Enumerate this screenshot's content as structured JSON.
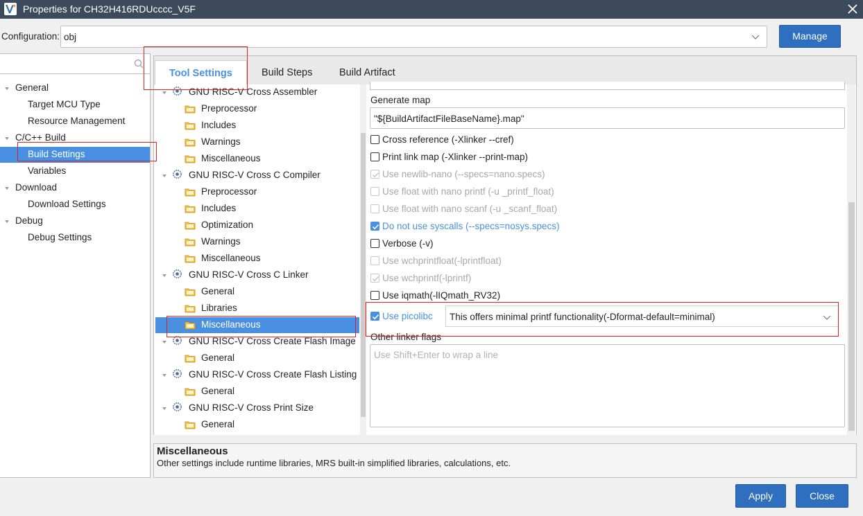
{
  "window": {
    "title": "Properties for CH32H416RDUcccc_V5F"
  },
  "config": {
    "label": "Configuration:",
    "value": "obj",
    "manage_label": "Manage"
  },
  "left_tree": {
    "filter_placeholder": "",
    "items": [
      {
        "label": "General"
      },
      {
        "label": "Target MCU Type"
      },
      {
        "label": "Resource Management"
      },
      {
        "label": "C/C++ Build"
      },
      {
        "label": "Build Settings"
      },
      {
        "label": "Variables"
      },
      {
        "label": "Download"
      },
      {
        "label": "Download Settings"
      },
      {
        "label": "Debug"
      },
      {
        "label": "Debug Settings"
      }
    ]
  },
  "tabs": [
    {
      "label": "Tool Settings"
    },
    {
      "label": "Build Steps"
    },
    {
      "label": "Build Artifact"
    }
  ],
  "tool_tree": {
    "items": [
      {
        "label": "GNU RISC-V Cross Assembler"
      },
      {
        "label": "Preprocessor"
      },
      {
        "label": "Includes"
      },
      {
        "label": "Warnings"
      },
      {
        "label": "Miscellaneous"
      },
      {
        "label": "GNU RISC-V Cross C Compiler"
      },
      {
        "label": "Preprocessor"
      },
      {
        "label": "Includes"
      },
      {
        "label": "Optimization"
      },
      {
        "label": "Warnings"
      },
      {
        "label": "Miscellaneous"
      },
      {
        "label": "GNU RISC-V Cross C Linker"
      },
      {
        "label": "General"
      },
      {
        "label": "Libraries"
      },
      {
        "label": "Miscellaneous"
      },
      {
        "label": "GNU RISC-V Cross Create Flash Image"
      },
      {
        "label": "General"
      },
      {
        "label": "GNU RISC-V Cross Create Flash Listing"
      },
      {
        "label": "General"
      },
      {
        "label": "GNU RISC-V Cross Print Size"
      },
      {
        "label": "General"
      }
    ]
  },
  "settings": {
    "generate_map_label": "Generate map",
    "generate_map_value": "\"${BuildArtifactFileBaseName}.map\"",
    "options": [
      {
        "label": "Cross reference (-Xlinker --cref)",
        "checked": false,
        "enabled": true
      },
      {
        "label": "Print link map (-Xlinker --print-map)",
        "checked": false,
        "enabled": true
      },
      {
        "label": "Use newlib-nano (--specs=nano.specs)",
        "checked": true,
        "enabled": false
      },
      {
        "label": "Use float with nano printf (-u _printf_float)",
        "checked": false,
        "enabled": false
      },
      {
        "label": "Use float with nano scanf (-u _scanf_float)",
        "checked": false,
        "enabled": false
      },
      {
        "label": "Do not use syscalls (--specs=nosys.specs)",
        "checked": true,
        "enabled": true
      },
      {
        "label": "Verbose (-v)",
        "checked": false,
        "enabled": true
      },
      {
        "label": "Use wchprintfloat(-lprintfloat)",
        "checked": false,
        "enabled": false
      },
      {
        "label": "Use wchprintf(-lprintf)",
        "checked": true,
        "enabled": false
      },
      {
        "label": "Use iqmath(-lIQmath_RV32)",
        "checked": false,
        "enabled": true
      }
    ],
    "picolibc_label": "Use picolibc",
    "picolibc_checked": true,
    "picolibc_option": "This offers minimal printf functionality(-Dformat-default=minimal)",
    "other_flags_label": "Other linker flags",
    "other_flags_placeholder": "Use Shift+Enter to wrap a line"
  },
  "description": {
    "heading": "Miscellaneous",
    "text": "Other settings include runtime libraries, MRS built-in simplified libraries, calculations, etc."
  },
  "footer": {
    "apply_label": "Apply",
    "close_label": "Close"
  },
  "colors": {
    "accent": "#4a90e2",
    "titlebar": "#3c4a5c",
    "button": "#2e6fbf",
    "annotation": "#e02020"
  }
}
